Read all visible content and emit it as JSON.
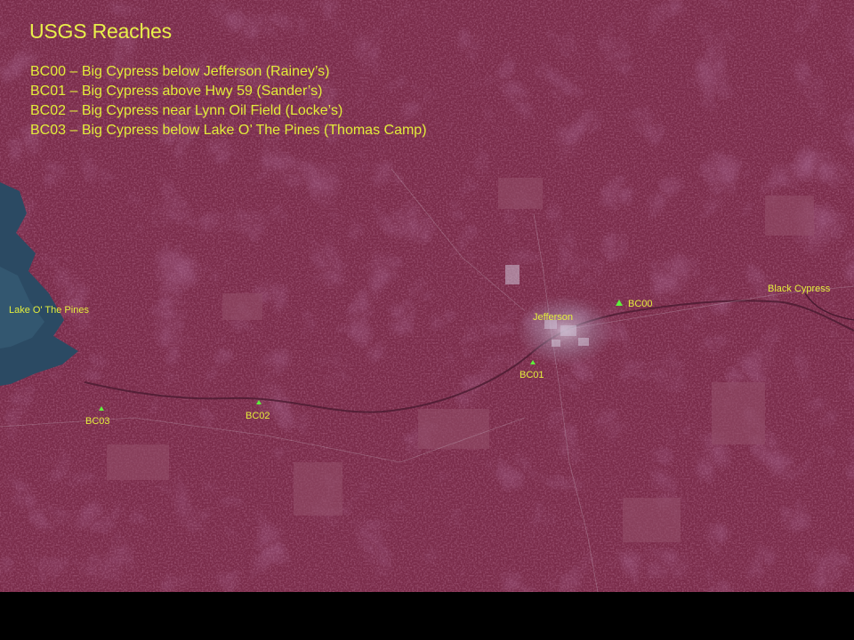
{
  "title": "USGS Reaches",
  "reaches": [
    "BC00 – Big Cypress below Jefferson (Rainey’s)",
    "BC01 – Big Cypress above Hwy 59 (Sander’s)",
    "BC02 – Big Cypress near Lynn Oil Field (Locke’s)",
    "BC03 – Big Cypress below Lake O’ The Pines (Thomas Camp)"
  ],
  "place_labels": {
    "lake": "Lake  O' The Pines",
    "town": "Jefferson",
    "creek": "Black Cypress"
  },
  "sites": {
    "bc00": "BC00",
    "bc01": "BC01",
    "bc02": "BC02",
    "bc03": "BC03"
  },
  "colors": {
    "terrain": "#7a2c4a",
    "terrain_dark": "#5c1d35",
    "water": "#2b4a63",
    "urban": "#b7a8c2",
    "label_text": "#e2ec3a",
    "site_marker": "#5ef03c",
    "background": "#000000"
  }
}
